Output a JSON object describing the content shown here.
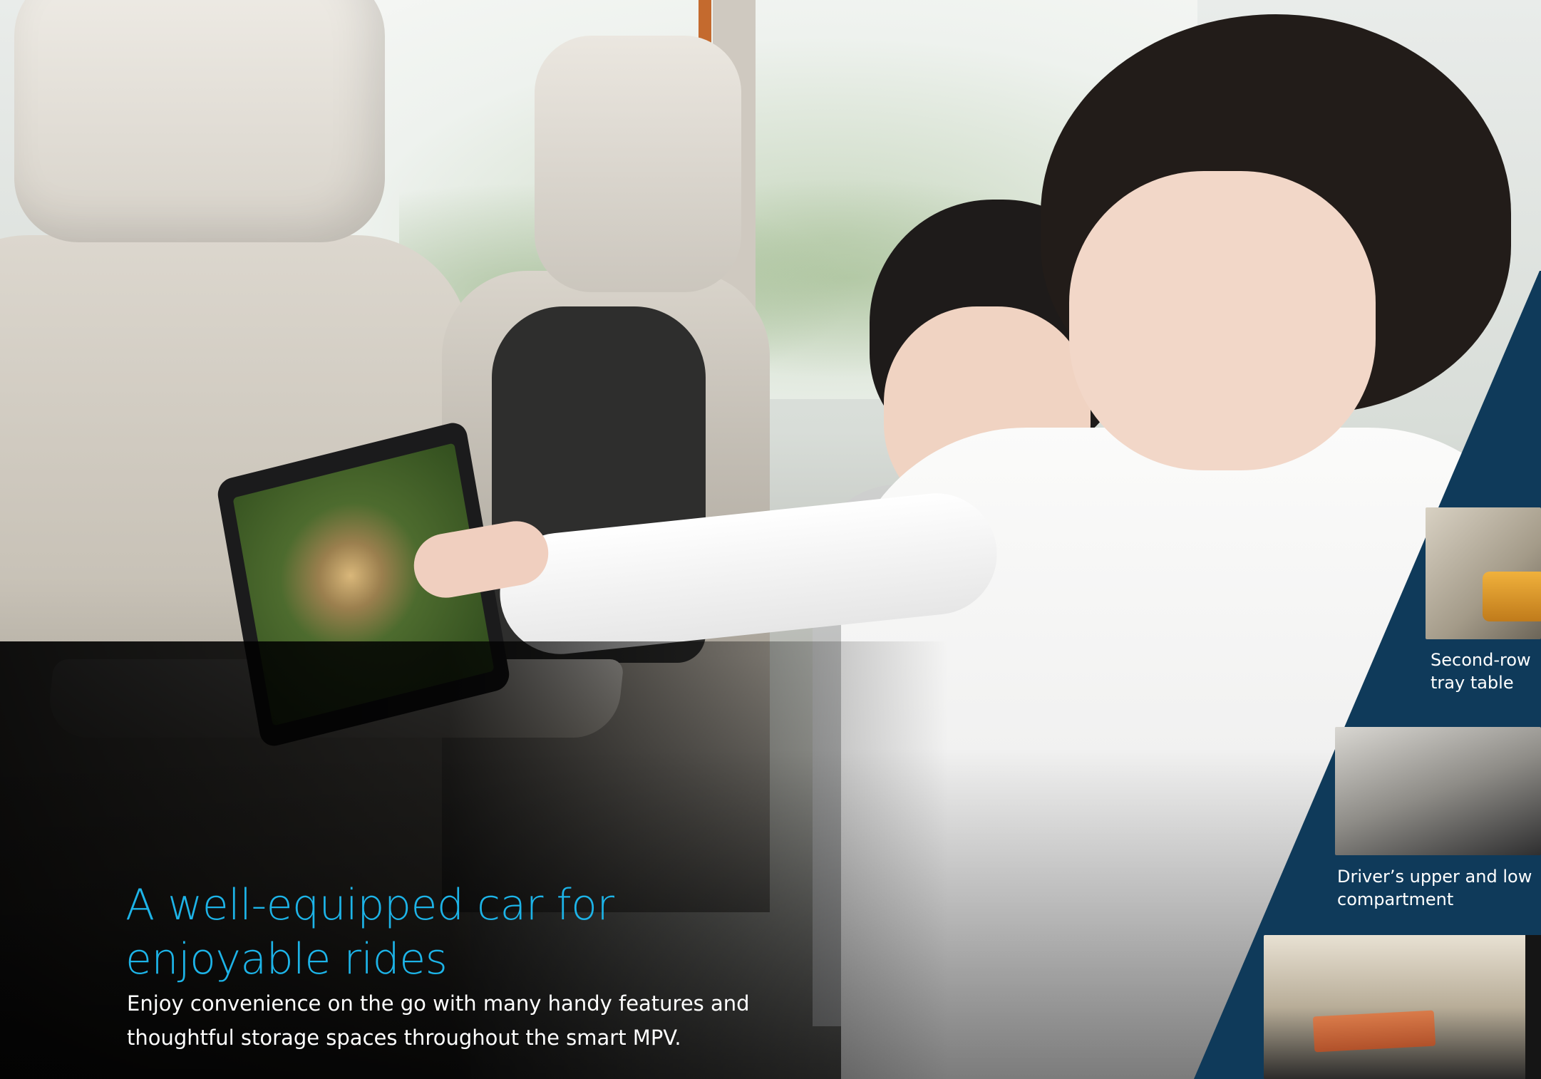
{
  "headline": {
    "line1": "A well-equipped car for",
    "line2": "enjoyable rides"
  },
  "body": {
    "line1": "Enjoy convenience on the go with many handy features and",
    "line2": "thoughtful storage spaces throughout the smart MPV."
  },
  "features": [
    {
      "line1": "Second-row",
      "line2": "tray table"
    },
    {
      "line1": "Driver’s upper and low",
      "line2": "compartment"
    }
  ],
  "colors": {
    "accent": "#1db4e8",
    "panel": "#0f3a5a",
    "text": "#ffffff"
  }
}
